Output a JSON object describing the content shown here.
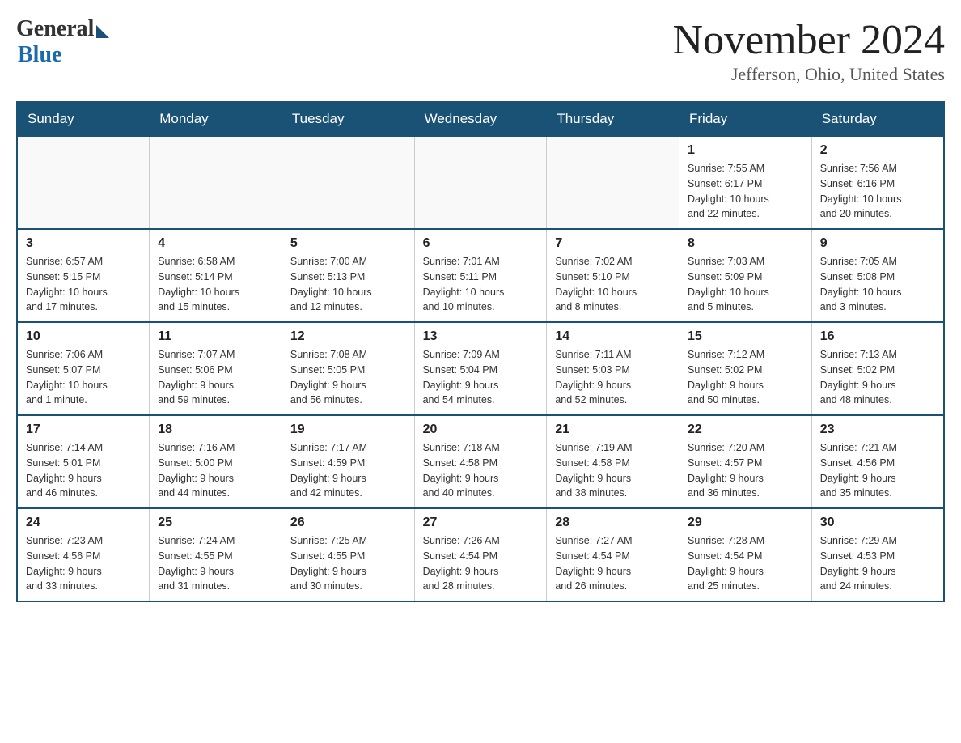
{
  "header": {
    "logo_general": "General",
    "logo_blue": "Blue",
    "month_title": "November 2024",
    "location": "Jefferson, Ohio, United States"
  },
  "days_of_week": [
    "Sunday",
    "Monday",
    "Tuesday",
    "Wednesday",
    "Thursday",
    "Friday",
    "Saturday"
  ],
  "weeks": [
    [
      {
        "day": "",
        "info": ""
      },
      {
        "day": "",
        "info": ""
      },
      {
        "day": "",
        "info": ""
      },
      {
        "day": "",
        "info": ""
      },
      {
        "day": "",
        "info": ""
      },
      {
        "day": "1",
        "info": "Sunrise: 7:55 AM\nSunset: 6:17 PM\nDaylight: 10 hours\nand 22 minutes."
      },
      {
        "day": "2",
        "info": "Sunrise: 7:56 AM\nSunset: 6:16 PM\nDaylight: 10 hours\nand 20 minutes."
      }
    ],
    [
      {
        "day": "3",
        "info": "Sunrise: 6:57 AM\nSunset: 5:15 PM\nDaylight: 10 hours\nand 17 minutes."
      },
      {
        "day": "4",
        "info": "Sunrise: 6:58 AM\nSunset: 5:14 PM\nDaylight: 10 hours\nand 15 minutes."
      },
      {
        "day": "5",
        "info": "Sunrise: 7:00 AM\nSunset: 5:13 PM\nDaylight: 10 hours\nand 12 minutes."
      },
      {
        "day": "6",
        "info": "Sunrise: 7:01 AM\nSunset: 5:11 PM\nDaylight: 10 hours\nand 10 minutes."
      },
      {
        "day": "7",
        "info": "Sunrise: 7:02 AM\nSunset: 5:10 PM\nDaylight: 10 hours\nand 8 minutes."
      },
      {
        "day": "8",
        "info": "Sunrise: 7:03 AM\nSunset: 5:09 PM\nDaylight: 10 hours\nand 5 minutes."
      },
      {
        "day": "9",
        "info": "Sunrise: 7:05 AM\nSunset: 5:08 PM\nDaylight: 10 hours\nand 3 minutes."
      }
    ],
    [
      {
        "day": "10",
        "info": "Sunrise: 7:06 AM\nSunset: 5:07 PM\nDaylight: 10 hours\nand 1 minute."
      },
      {
        "day": "11",
        "info": "Sunrise: 7:07 AM\nSunset: 5:06 PM\nDaylight: 9 hours\nand 59 minutes."
      },
      {
        "day": "12",
        "info": "Sunrise: 7:08 AM\nSunset: 5:05 PM\nDaylight: 9 hours\nand 56 minutes."
      },
      {
        "day": "13",
        "info": "Sunrise: 7:09 AM\nSunset: 5:04 PM\nDaylight: 9 hours\nand 54 minutes."
      },
      {
        "day": "14",
        "info": "Sunrise: 7:11 AM\nSunset: 5:03 PM\nDaylight: 9 hours\nand 52 minutes."
      },
      {
        "day": "15",
        "info": "Sunrise: 7:12 AM\nSunset: 5:02 PM\nDaylight: 9 hours\nand 50 minutes."
      },
      {
        "day": "16",
        "info": "Sunrise: 7:13 AM\nSunset: 5:02 PM\nDaylight: 9 hours\nand 48 minutes."
      }
    ],
    [
      {
        "day": "17",
        "info": "Sunrise: 7:14 AM\nSunset: 5:01 PM\nDaylight: 9 hours\nand 46 minutes."
      },
      {
        "day": "18",
        "info": "Sunrise: 7:16 AM\nSunset: 5:00 PM\nDaylight: 9 hours\nand 44 minutes."
      },
      {
        "day": "19",
        "info": "Sunrise: 7:17 AM\nSunset: 4:59 PM\nDaylight: 9 hours\nand 42 minutes."
      },
      {
        "day": "20",
        "info": "Sunrise: 7:18 AM\nSunset: 4:58 PM\nDaylight: 9 hours\nand 40 minutes."
      },
      {
        "day": "21",
        "info": "Sunrise: 7:19 AM\nSunset: 4:58 PM\nDaylight: 9 hours\nand 38 minutes."
      },
      {
        "day": "22",
        "info": "Sunrise: 7:20 AM\nSunset: 4:57 PM\nDaylight: 9 hours\nand 36 minutes."
      },
      {
        "day": "23",
        "info": "Sunrise: 7:21 AM\nSunset: 4:56 PM\nDaylight: 9 hours\nand 35 minutes."
      }
    ],
    [
      {
        "day": "24",
        "info": "Sunrise: 7:23 AM\nSunset: 4:56 PM\nDaylight: 9 hours\nand 33 minutes."
      },
      {
        "day": "25",
        "info": "Sunrise: 7:24 AM\nSunset: 4:55 PM\nDaylight: 9 hours\nand 31 minutes."
      },
      {
        "day": "26",
        "info": "Sunrise: 7:25 AM\nSunset: 4:55 PM\nDaylight: 9 hours\nand 30 minutes."
      },
      {
        "day": "27",
        "info": "Sunrise: 7:26 AM\nSunset: 4:54 PM\nDaylight: 9 hours\nand 28 minutes."
      },
      {
        "day": "28",
        "info": "Sunrise: 7:27 AM\nSunset: 4:54 PM\nDaylight: 9 hours\nand 26 minutes."
      },
      {
        "day": "29",
        "info": "Sunrise: 7:28 AM\nSunset: 4:54 PM\nDaylight: 9 hours\nand 25 minutes."
      },
      {
        "day": "30",
        "info": "Sunrise: 7:29 AM\nSunset: 4:53 PM\nDaylight: 9 hours\nand 24 minutes."
      }
    ]
  ]
}
